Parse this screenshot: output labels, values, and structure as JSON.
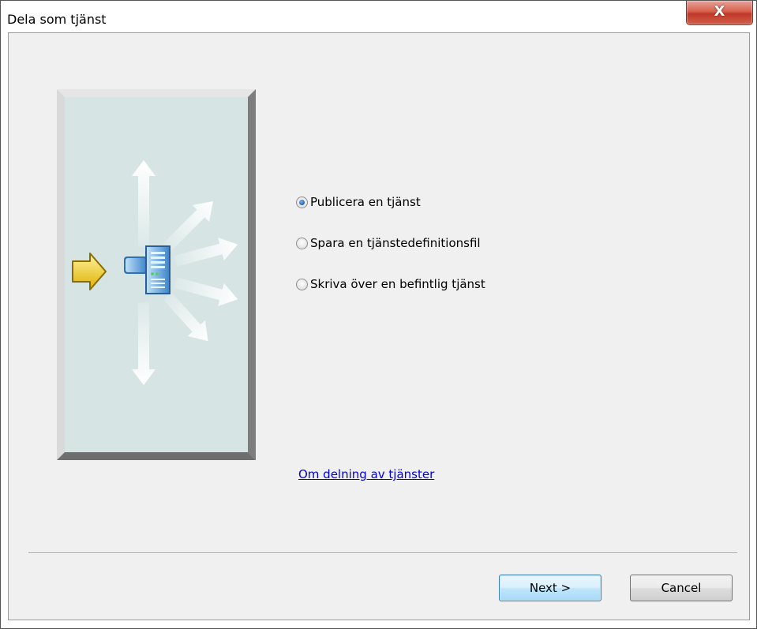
{
  "window": {
    "title": "Dela som tjänst",
    "close_glyph": "X",
    "close_icon": "close-icon"
  },
  "illustration": {
    "icon": "service-publish-illustration",
    "colors": {
      "panel": "#d6e4e4",
      "frame_light": "#e2e2e2",
      "frame_dark": "#7b7b7b",
      "arrow": "#f2c200",
      "server": "#4f8fd0"
    }
  },
  "options": {
    "items": [
      {
        "label": "Publicera en tjänst",
        "checked": true
      },
      {
        "label": "Spara en tjänstedefinitionsfil",
        "checked": false
      },
      {
        "label": "Skriva över en befintlig tjänst",
        "checked": false
      }
    ]
  },
  "help_link": {
    "label": "Om delning av tjänster"
  },
  "buttons": {
    "next_label": "Next >",
    "cancel_label": "Cancel"
  }
}
